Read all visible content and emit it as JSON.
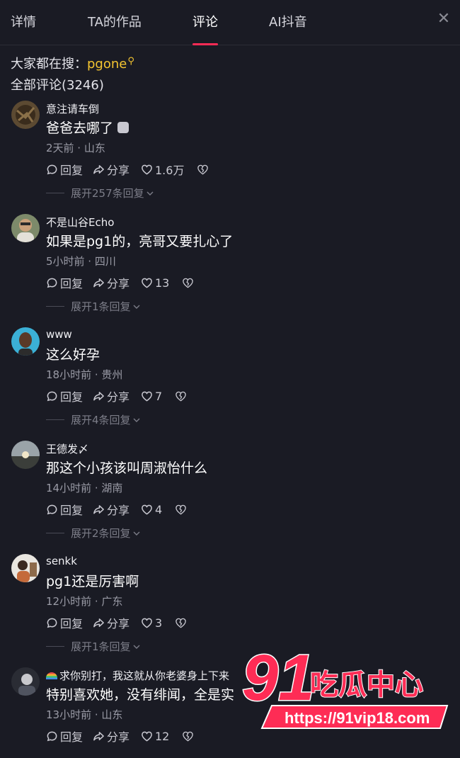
{
  "tabs": [
    {
      "label": "详情"
    },
    {
      "label": "TA的作品"
    },
    {
      "label": "评论"
    },
    {
      "label": "AI抖音"
    }
  ],
  "search": {
    "prefix": "大家都在搜：",
    "keyword": "pgone"
  },
  "comments_total": "全部评论(3246)",
  "actions": {
    "reply": "回复",
    "share": "分享"
  },
  "comments": [
    {
      "user": "意注请车倒",
      "text": "爸爸去哪了",
      "meta": "2天前 · 山东",
      "likes": "1.6万",
      "expand": "展开257条回复"
    },
    {
      "user": "不是山谷Echo",
      "text": "如果是pg1的，亮哥又要扎心了",
      "meta": "5小时前 · 四川",
      "likes": "13",
      "expand": "展开1条回复"
    },
    {
      "user": "www",
      "text": "这么好孕",
      "meta": "18小时前 · 贵州",
      "likes": "7",
      "expand": "展开4条回复"
    },
    {
      "user": "王德发〆",
      "text": "那这个小孩该叫周淑怡什么",
      "meta": "14小时前 · 湖南",
      "likes": "4",
      "expand": "展开2条回复"
    },
    {
      "user": "senkk",
      "text": "pg1还是厉害啊",
      "meta": "12小时前 · 广东",
      "likes": "3",
      "expand": "展开1条回复"
    },
    {
      "user": "求你别打，我这就从你老婆身上下来",
      "text": "特别喜欢她，没有绯闻，全是实",
      "meta": "13小时前 · 山东",
      "likes": "12",
      "expand": ""
    }
  ],
  "watermark": {
    "number": "91",
    "text": "吃瓜中心",
    "url": "https://91vip18.com"
  },
  "colors": {
    "accent": "#fe2c55",
    "keyword": "#f4c531",
    "background": "#1a1b24"
  }
}
